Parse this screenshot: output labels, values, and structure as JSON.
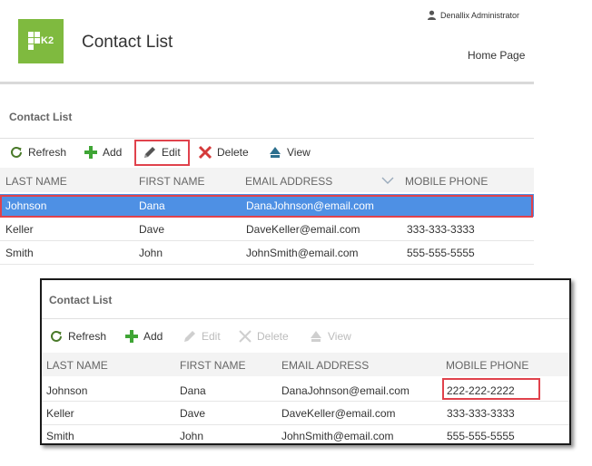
{
  "header": {
    "logo_text": "K2",
    "title": "Contact List",
    "user_name": "Denallix Administrator",
    "home_link": "Home Page"
  },
  "panel_top": {
    "section_title": "Contact List",
    "toolbar": {
      "refresh": "Refresh",
      "add": "Add",
      "edit": "Edit",
      "delete": "Delete",
      "view": "View"
    },
    "columns": [
      "LAST NAME",
      "FIRST NAME",
      "EMAIL ADDRESS",
      "MOBILE PHONE"
    ],
    "rows": [
      {
        "last": "Johnson",
        "first": "Dana",
        "email": "DanaJohnson@email.com",
        "phone": ""
      },
      {
        "last": "Keller",
        "first": "Dave",
        "email": "DaveKeller@email.com",
        "phone": "333-333-3333"
      },
      {
        "last": "Smith",
        "first": "John",
        "email": "JohnSmith@email.com",
        "phone": "555-555-5555"
      }
    ]
  },
  "panel_bottom": {
    "section_title": "Contact List",
    "toolbar": {
      "refresh": "Refresh",
      "add": "Add",
      "edit": "Edit",
      "delete": "Delete",
      "view": "View"
    },
    "columns": [
      "LAST NAME",
      "FIRST NAME",
      "EMAIL ADDRESS",
      "MOBILE PHONE"
    ],
    "rows": [
      {
        "last": "Johnson",
        "first": "Dana",
        "email": "DanaJohnson@email.com",
        "phone": "222-222-2222"
      },
      {
        "last": "Keller",
        "first": "Dave",
        "email": "DaveKeller@email.com",
        "phone": "333-333-3333"
      },
      {
        "last": "Smith",
        "first": "John",
        "email": "JohnSmith@email.com",
        "phone": "555-555-5555"
      }
    ]
  },
  "colors": {
    "brand": "#7fba3f",
    "selection": "#4e90e4",
    "highlight": "#e0424c",
    "add_icon": "#3fa535",
    "delete_icon": "#d43a3a",
    "view_icon": "#2c6f8e"
  },
  "icons": [
    "k2-logo-icon",
    "user-icon",
    "refresh-icon",
    "add-icon",
    "edit-icon",
    "delete-icon",
    "view-icon",
    "sort-chevron-icon"
  ]
}
